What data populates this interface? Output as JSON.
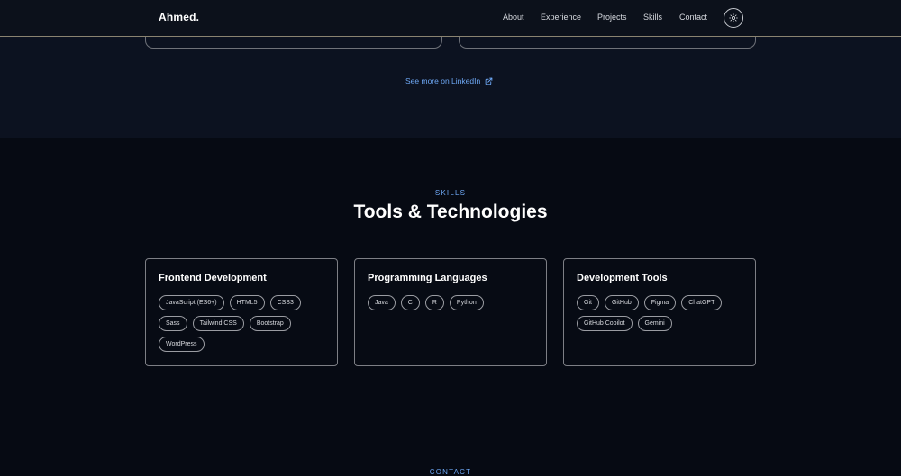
{
  "header": {
    "logo": "Ahmed.",
    "nav": [
      {
        "label": "About"
      },
      {
        "label": "Experience"
      },
      {
        "label": "Projects"
      },
      {
        "label": "Skills"
      },
      {
        "label": "Contact"
      }
    ],
    "theme_toggle_icon": "sun-icon"
  },
  "experience": {
    "linkedin_link": "See more on LinkedIn",
    "linkedin_icon": "external-link-icon"
  },
  "skills": {
    "eyebrow": "SKILLS",
    "title": "Tools & Technologies",
    "cards": [
      {
        "title": "Frontend Development",
        "tags": [
          "JavaScript (ES6+)",
          "HTML5",
          "CSS3",
          "Sass",
          "Tailwind CSS",
          "Bootstrap",
          "WordPress"
        ]
      },
      {
        "title": "Programming Languages",
        "tags": [
          "Java",
          "C",
          "R",
          "Python"
        ]
      },
      {
        "title": "Development Tools",
        "tags": [
          "Git",
          "GitHub",
          "Figma",
          "ChatGPT",
          "GitHub Copilot",
          "Gemini"
        ]
      }
    ]
  },
  "contact": {
    "eyebrow": "CONTACT"
  },
  "colors": {
    "accent": "#6ea8f5",
    "background": "#060a13",
    "header_border": "#8a8370"
  }
}
